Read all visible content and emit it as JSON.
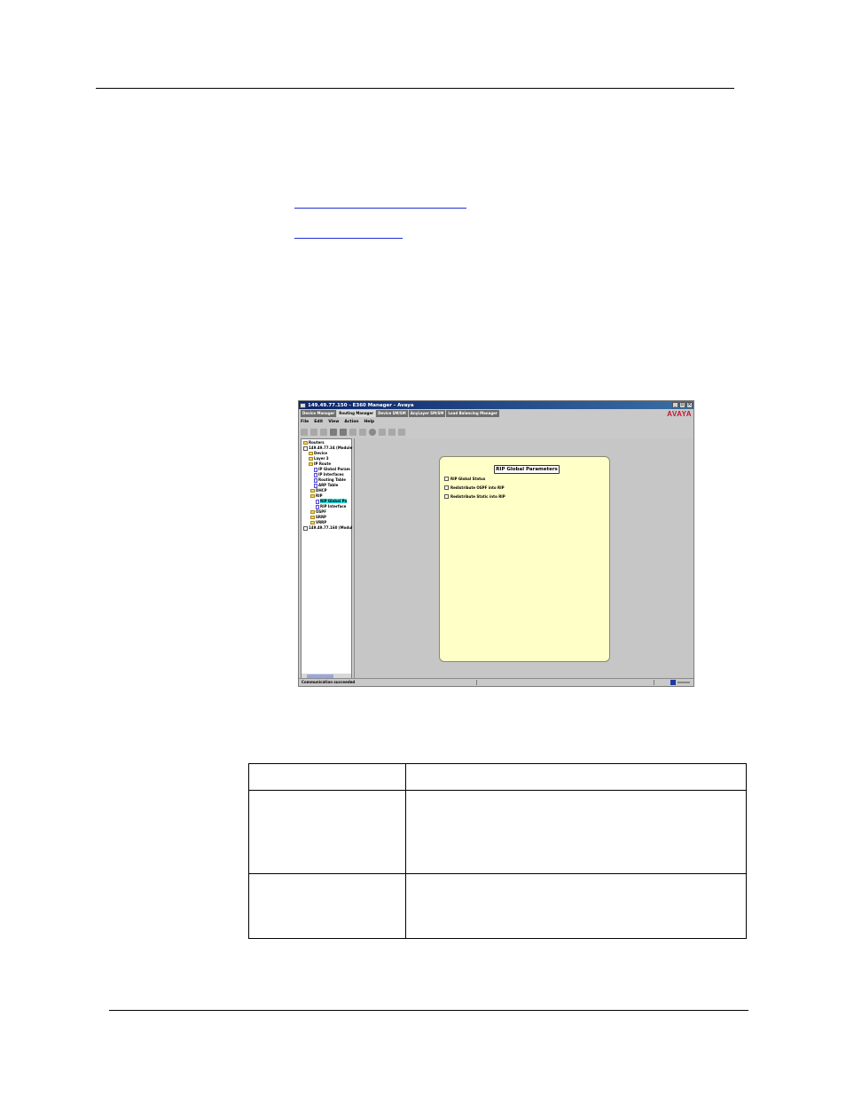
{
  "window": {
    "title": "149.49.77.150 - E360 Manager - Avaya",
    "controls": [
      "_",
      "▫",
      "×"
    ],
    "tabs": [
      "Device Manager",
      "Routing Manager",
      "Device SM/SM",
      "AnyLayer SM/SM",
      "Load Balancing Manager"
    ],
    "active_tab": "Routing Manager",
    "logo": "AVAYA",
    "menu": [
      "File",
      "Edit",
      "View",
      "Action",
      "Help"
    ],
    "tree": [
      "Routers",
      "149.49.77.34 (Module",
      "Device",
      "Layer 3",
      "IP Route",
      "IP Global Param",
      "IP Interfaces",
      "Routing Table",
      "ARP Table",
      "DHCP",
      "RIP",
      "RIP Global Pa",
      "RIP Interface",
      "OSPF",
      "SRRP",
      "VRRP",
      "149.49.77.160 (Modul"
    ],
    "panel": {
      "title": "RIP Global Parameters",
      "options": [
        "RIP Global Status",
        "Redistribute OSPF into RIP",
        "Redistribute Static into RIP"
      ]
    },
    "status": "Communication succeeded"
  }
}
